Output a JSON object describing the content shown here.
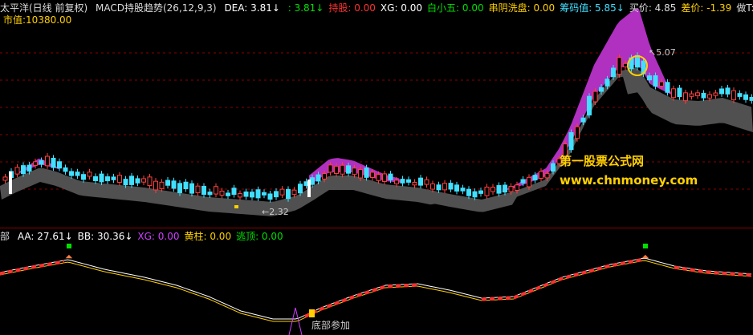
{
  "header": {
    "title": "太平洋(日线 前复权)",
    "indicator_name": "MACD持股趋势(26,12,9,3)",
    "items": [
      {
        "label": "DEA:",
        "value": "3.81↓",
        "color": "#ffffff",
        "vcolor": "#ffffff"
      },
      {
        "label": "",
        "value": ": 3.81↓",
        "color": "#00e000",
        "vcolor": "#00e000"
      },
      {
        "label": "持股:",
        "value": "0.00",
        "color": "#ff3030",
        "vcolor": "#ff3030"
      },
      {
        "label": "XG:",
        "value": "0.00",
        "color": "#ffffff",
        "vcolor": "#ffffff"
      },
      {
        "label": "白小五:",
        "value": "0.00",
        "color": "#00e000",
        "vcolor": "#00e000"
      },
      {
        "label": "串阴洗盘:",
        "value": "0.00",
        "color": "#ffd000",
        "vcolor": "#ffd000"
      },
      {
        "label": "筹码值:",
        "value": "5.85↓",
        "color": "#40e0ff",
        "vcolor": "#40e0ff"
      },
      {
        "label": "买价:",
        "value": "4.85",
        "color": "#dddddd",
        "vcolor": "#dddddd"
      },
      {
        "label": "差价:",
        "value": "-1.39",
        "color": "#ffd000",
        "vcolor": "#ffd000"
      },
      {
        "label": "做T:",
        "value": "",
        "color": "#dddddd",
        "vcolor": "#dddddd"
      }
    ],
    "market_value_label": "市值:",
    "market_value": "10380.00"
  },
  "annotations": {
    "high": "5.07",
    "low": "2.32",
    "bottom_join": "底部参加"
  },
  "watermark": {
    "line1": "第一股票公式网",
    "line2": "www.chnmoney.com"
  },
  "sub_header": {
    "prefix": "部",
    "items": [
      {
        "label": "AA:",
        "value": "27.61↓",
        "color": "#ffffff"
      },
      {
        "label": "BB:",
        "value": "30.36↓",
        "color": "#ffffff"
      },
      {
        "label": "XG:",
        "value": "0.00",
        "color": "#d040ff"
      },
      {
        "label": "黄柱:",
        "value": "0.00",
        "color": "#ffd000"
      },
      {
        "label": "逃顶:",
        "value": "0.00",
        "color": "#00e000"
      }
    ]
  },
  "chart_data": {
    "type": "candlestick",
    "price_high": 5.07,
    "price_low": 2.32,
    "colors": {
      "up": "#ff4040",
      "down": "#40e0ff",
      "band_purple": "#b030c0",
      "band_gray": "#505050",
      "grid": "#8b0000"
    }
  }
}
